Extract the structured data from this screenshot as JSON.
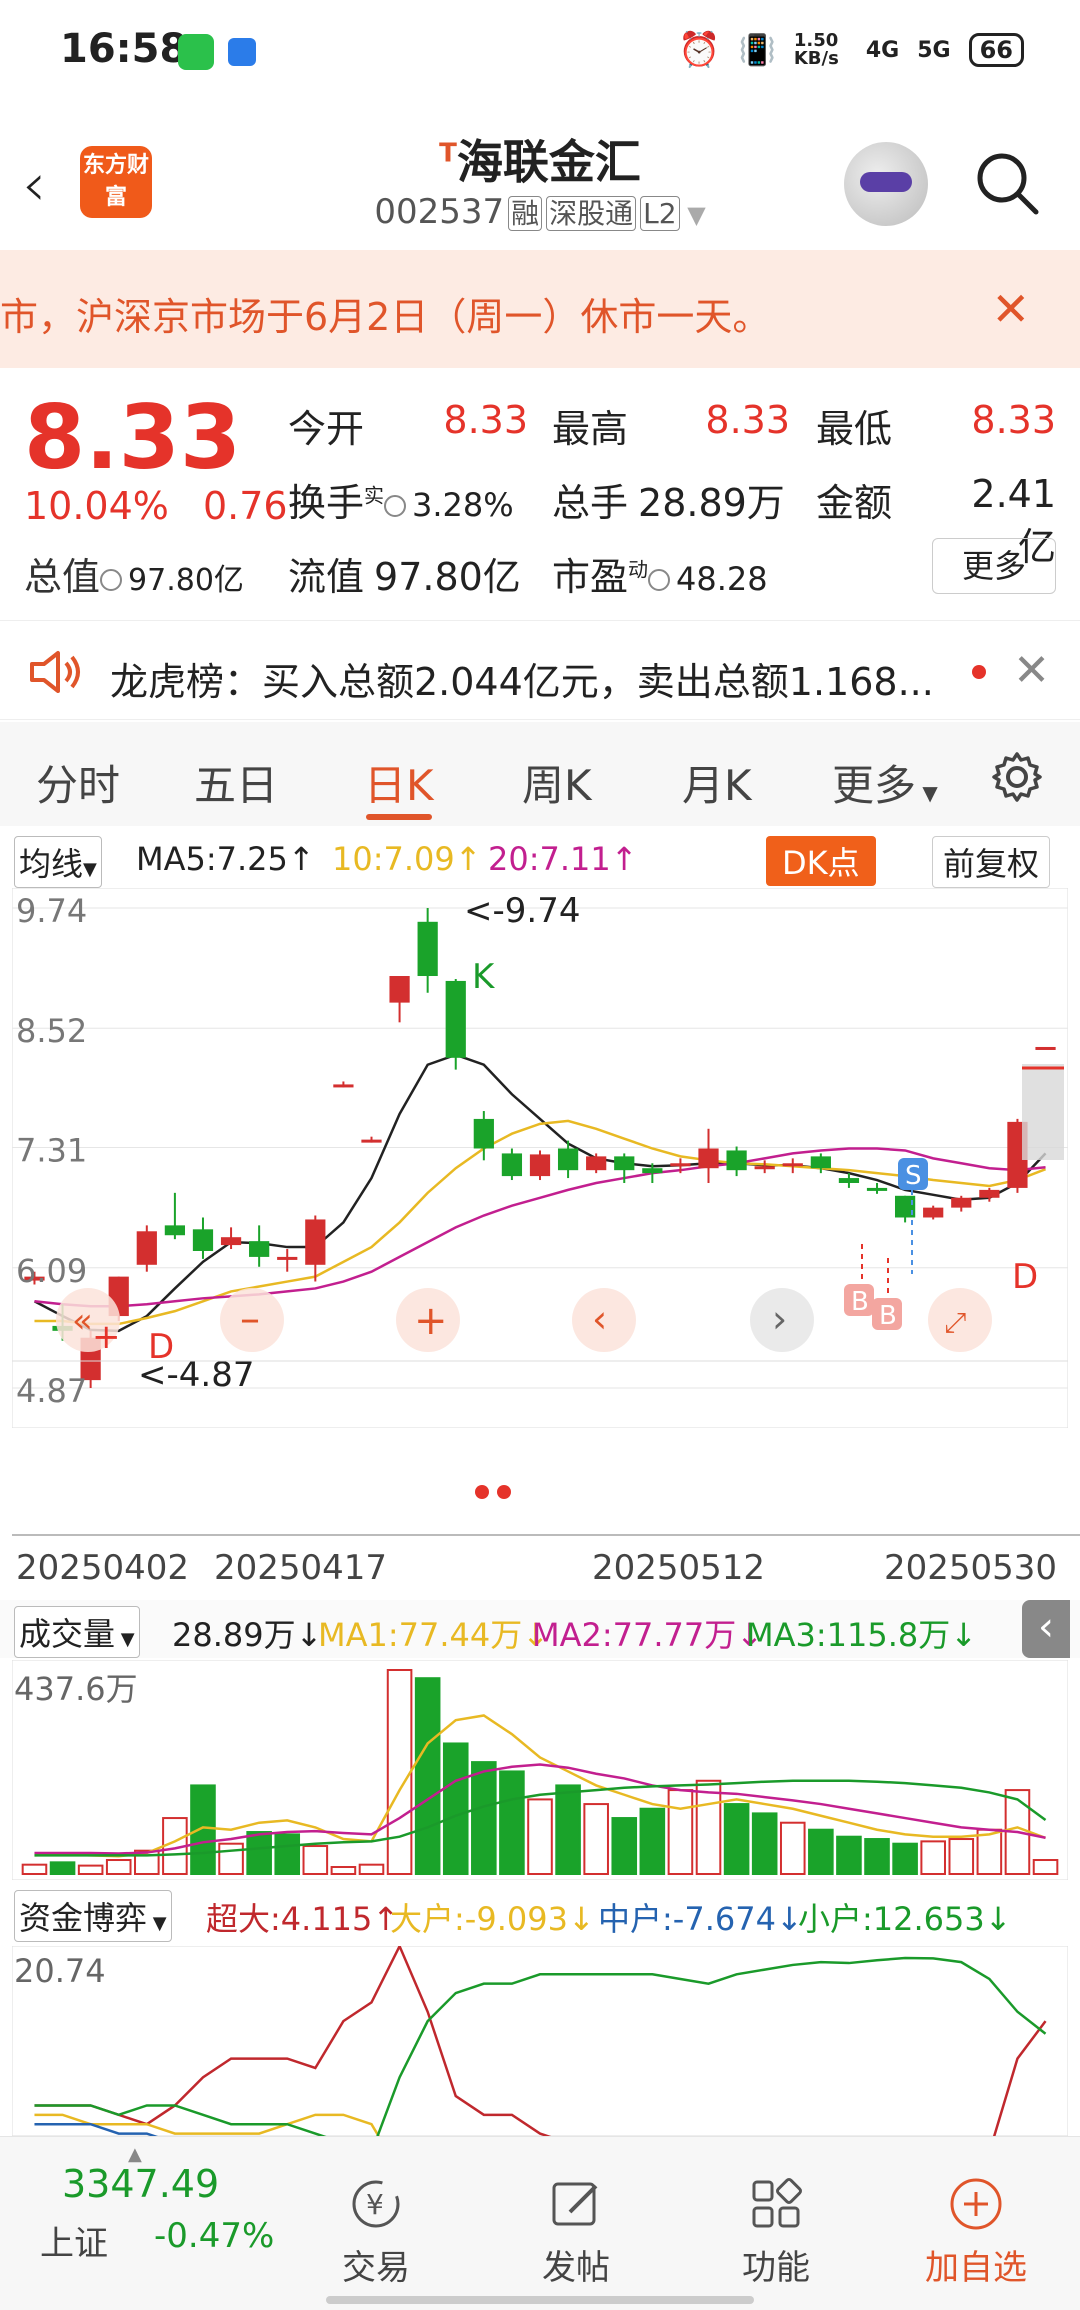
{
  "status_bar": {
    "time": "16:58",
    "net_speed": "1.50 KB/s",
    "signal_1": "4G",
    "signal_2": "5G",
    "battery": "66"
  },
  "header": {
    "logo_text": "东方财富",
    "title_prefix": "T",
    "title": "海联金汇",
    "code": "002537",
    "tag_1": "融",
    "tag_2": "深股通",
    "tag_3": "L2"
  },
  "notice": {
    "text": "市，沪深京市场于6月2日（周一）休市一天。"
  },
  "quote": {
    "price": "8.33",
    "change_pct": "10.04%",
    "change": "0.76",
    "open_label": "今开",
    "open": "8.33",
    "high_label": "最高",
    "high": "8.33",
    "low_label": "最低",
    "low": "8.33",
    "turnover_label": "换手",
    "turnover_sup": "实",
    "turnover": "3.28%",
    "volume_label": "总手",
    "volume": "28.89万",
    "amount_label": "金额",
    "amount": "2.41亿",
    "mktcap_label": "总值",
    "mktcap": "97.80亿",
    "float_label": "流值",
    "float_cap": "97.80亿",
    "pe_label": "市盈",
    "pe_sup": "动",
    "pe": "48.28",
    "more_label": "更多"
  },
  "lhb": {
    "text": "龙虎榜：买入总额2.044亿元，卖出总额1.168..."
  },
  "tabs": [
    "分时",
    "五日",
    "日K",
    "周K",
    "月K",
    "更多"
  ],
  "active_tab": "日K",
  "ma_bar": {
    "selector": "均线",
    "ma5": "MA5:7.25",
    "ma10": "10:7.09",
    "ma20": "20:7.11",
    "dk_label": "DK点",
    "adjust_label": "前复权",
    "color_ma5": "#222222",
    "color_ma10": "#e8b923",
    "color_ma20": "#c21f8f"
  },
  "kline_labels": {
    "y_ticks": [
      "9.74",
      "8.52",
      "7.31",
      "6.09",
      "4.87"
    ],
    "high_note": "<-9.74",
    "low_note": "<-4.87",
    "k_mark": "K",
    "d_mark": "D",
    "s_mark": "S",
    "b_mark": "B",
    "dates": [
      "20250402",
      "20250417",
      "20250512",
      "20250530"
    ]
  },
  "volume_bar": {
    "selector": "成交量",
    "value": "28.89万",
    "ma1": "MA1:77.44万",
    "ma2": "MA2:77.77万",
    "ma3": "MA3:115.8万",
    "y_top": "437.6万",
    "color_ma1": "#e8b923",
    "color_ma2": "#c21f8f",
    "color_ma3": "#1a9a2a"
  },
  "fund_bar": {
    "selector": "资金博弈",
    "super": "超大:4.115",
    "large": "大户:-9.093",
    "mid": "中户:-7.674",
    "small": "小户:12.653",
    "y_top": "20.74",
    "color_super": "#c0282d",
    "color_large": "#e8b923",
    "color_mid": "#2563b0",
    "color_small": "#1a9a2a"
  },
  "chart_data": {
    "type": "candlestick",
    "y_range": [
      4.87,
      9.74
    ],
    "candles": [
      {
        "o": 6.0,
        "h": 6.05,
        "l": 5.92,
        "c": 5.96,
        "up": true
      },
      {
        "o": 5.5,
        "h": 5.72,
        "l": 5.35,
        "c": 5.45,
        "up": false
      },
      {
        "o": 4.95,
        "h": 5.45,
        "l": 4.87,
        "c": 5.38,
        "up": true
      },
      {
        "o": 5.6,
        "h": 6.0,
        "l": 5.55,
        "c": 6.0,
        "up": true
      },
      {
        "o": 6.12,
        "h": 6.52,
        "l": 6.05,
        "c": 6.46,
        "up": true
      },
      {
        "o": 6.52,
        "h": 6.85,
        "l": 6.38,
        "c": 6.42,
        "up": false
      },
      {
        "o": 6.48,
        "h": 6.6,
        "l": 6.18,
        "c": 6.26,
        "up": false
      },
      {
        "o": 6.32,
        "h": 6.5,
        "l": 6.28,
        "c": 6.4,
        "up": true
      },
      {
        "o": 6.36,
        "h": 6.52,
        "l": 6.1,
        "c": 6.2,
        "up": false
      },
      {
        "o": 6.2,
        "h": 6.28,
        "l": 6.05,
        "c": 6.18,
        "up": true
      },
      {
        "o": 6.12,
        "h": 6.62,
        "l": 5.95,
        "c": 6.58,
        "up": true
      },
      {
        "o": 7.95,
        "h": 7.98,
        "l": 7.92,
        "c": 7.95,
        "up": true
      },
      {
        "o": 7.39,
        "h": 7.42,
        "l": 7.36,
        "c": 7.39,
        "up": true
      },
      {
        "o": 8.78,
        "h": 9.0,
        "l": 8.58,
        "c": 9.05,
        "up": true
      },
      {
        "o": 9.05,
        "h": 9.74,
        "l": 8.88,
        "c": 9.6,
        "up": false
      },
      {
        "o": 9.0,
        "h": 9.02,
        "l": 8.1,
        "c": 8.22,
        "up": false
      },
      {
        "o": 7.6,
        "h": 7.68,
        "l": 7.18,
        "c": 7.3,
        "up": false
      },
      {
        "o": 7.25,
        "h": 7.3,
        "l": 6.98,
        "c": 7.02,
        "up": false
      },
      {
        "o": 7.02,
        "h": 7.28,
        "l": 6.98,
        "c": 7.24,
        "up": true
      },
      {
        "o": 7.3,
        "h": 7.38,
        "l": 7.0,
        "c": 7.08,
        "up": false
      },
      {
        "o": 7.08,
        "h": 7.25,
        "l": 7.05,
        "c": 7.22,
        "up": true
      },
      {
        "o": 7.22,
        "h": 7.25,
        "l": 6.95,
        "c": 7.08,
        "up": false
      },
      {
        "o": 7.1,
        "h": 7.15,
        "l": 6.95,
        "c": 7.05,
        "up": false
      },
      {
        "o": 7.12,
        "h": 7.2,
        "l": 7.05,
        "c": 7.15,
        "up": true
      },
      {
        "o": 7.1,
        "h": 7.5,
        "l": 6.95,
        "c": 7.3,
        "up": true
      },
      {
        "o": 7.28,
        "h": 7.32,
        "l": 7.02,
        "c": 7.08,
        "up": false
      },
      {
        "o": 7.12,
        "h": 7.18,
        "l": 7.05,
        "c": 7.12,
        "up": true
      },
      {
        "o": 7.15,
        "h": 7.2,
        "l": 7.05,
        "c": 7.15,
        "up": true
      },
      {
        "o": 7.22,
        "h": 7.25,
        "l": 7.05,
        "c": 7.1,
        "up": false
      },
      {
        "o": 7.0,
        "h": 7.05,
        "l": 6.9,
        "c": 6.95,
        "up": false
      },
      {
        "o": 6.9,
        "h": 6.95,
        "l": 6.84,
        "c": 6.88,
        "up": false
      },
      {
        "o": 6.82,
        "h": 6.82,
        "l": 6.55,
        "c": 6.6,
        "up": false
      },
      {
        "o": 6.6,
        "h": 6.72,
        "l": 6.58,
        "c": 6.7,
        "up": true
      },
      {
        "o": 6.7,
        "h": 6.82,
        "l": 6.66,
        "c": 6.8,
        "up": true
      },
      {
        "o": 6.8,
        "h": 6.9,
        "l": 6.76,
        "c": 6.88,
        "up": true
      },
      {
        "o": 6.9,
        "h": 7.6,
        "l": 6.85,
        "c": 7.57,
        "up": true
      },
      {
        "o": 8.33,
        "h": 8.33,
        "l": 8.33,
        "c": 8.33,
        "up": true
      }
    ],
    "ma5": [
      5.75,
      5.6,
      5.46,
      5.45,
      5.6,
      5.88,
      6.15,
      6.35,
      6.34,
      6.3,
      6.3,
      6.55,
      7.0,
      7.65,
      8.15,
      8.25,
      8.15,
      7.85,
      7.6,
      7.35,
      7.2,
      7.15,
      7.12,
      7.13,
      7.15,
      7.15,
      7.13,
      7.13,
      7.1,
      7.05,
      6.98,
      6.88,
      6.83,
      6.78,
      6.8,
      6.95,
      7.25
    ],
    "ma10": [
      5.55,
      5.55,
      5.52,
      5.52,
      5.58,
      5.65,
      5.75,
      5.85,
      5.9,
      5.95,
      6.0,
      6.15,
      6.3,
      6.55,
      6.85,
      7.1,
      7.3,
      7.45,
      7.55,
      7.58,
      7.5,
      7.4,
      7.3,
      7.22,
      7.18,
      7.15,
      7.14,
      7.12,
      7.1,
      7.08,
      7.05,
      7.02,
      6.98,
      6.95,
      6.92,
      6.98,
      7.09
    ],
    "ma20": [
      5.75,
      5.72,
      5.7,
      5.7,
      5.72,
      5.75,
      5.78,
      5.8,
      5.82,
      5.85,
      5.88,
      5.95,
      6.05,
      6.2,
      6.35,
      6.5,
      6.62,
      6.72,
      6.8,
      6.88,
      6.95,
      7.0,
      7.05,
      7.08,
      7.12,
      7.15,
      7.2,
      7.25,
      7.28,
      7.3,
      7.3,
      7.28,
      7.2,
      7.15,
      7.1,
      7.08,
      7.11
    ],
    "volume_max": 437.6,
    "volumes": [
      20,
      25,
      18,
      30,
      50,
      120,
      190,
      65,
      90,
      85,
      60,
      15,
      20,
      437.6,
      420,
      280,
      240,
      220,
      160,
      190,
      150,
      120,
      140,
      180,
      200,
      150,
      130,
      110,
      95,
      80,
      75,
      65,
      70,
      75,
      95,
      180,
      30
    ],
    "vol_up": [
      true,
      false,
      true,
      true,
      true,
      true,
      false,
      true,
      false,
      false,
      true,
      true,
      true,
      true,
      false,
      false,
      false,
      false,
      true,
      false,
      true,
      false,
      false,
      true,
      true,
      false,
      false,
      true,
      false,
      false,
      false,
      false,
      true,
      true,
      true,
      true,
      true
    ],
    "vma1": [
      40,
      42,
      40,
      38,
      45,
      70,
      100,
      95,
      110,
      115,
      100,
      75,
      70,
      180,
      280,
      330,
      340,
      300,
      250,
      220,
      190,
      170,
      150,
      140,
      150,
      160,
      150,
      140,
      125,
      110,
      95,
      85,
      80,
      80,
      85,
      100,
      77.44
    ],
    "vma2": [
      45,
      45,
      45,
      44,
      46,
      55,
      68,
      75,
      85,
      90,
      92,
      88,
      85,
      120,
      160,
      200,
      220,
      230,
      235,
      228,
      215,
      205,
      190,
      180,
      175,
      172,
      165,
      158,
      150,
      140,
      130,
      120,
      110,
      100,
      95,
      90,
      77.77
    ],
    "vma3": [
      40,
      40,
      40,
      40,
      40,
      42,
      45,
      50,
      55,
      60,
      65,
      68,
      70,
      80,
      100,
      125,
      145,
      160,
      170,
      175,
      180,
      185,
      188,
      190,
      192,
      195,
      198,
      200,
      200,
      200,
      198,
      195,
      190,
      185,
      175,
      160,
      115.8
    ],
    "fund_super": [
      5,
      5,
      5,
      4,
      3,
      5,
      8,
      10,
      10,
      10,
      9,
      14,
      16,
      22,
      15,
      6,
      4,
      4,
      2,
      1,
      0,
      0,
      0,
      0,
      0,
      0,
      0,
      0,
      0,
      0,
      0,
      0,
      0,
      0,
      0,
      10,
      14
    ],
    "fund_large": [
      4,
      4,
      3,
      3,
      3,
      2,
      2,
      2,
      2,
      3,
      4,
      4,
      3,
      -2,
      -8,
      -10,
      -10,
      -10,
      -10,
      -10,
      -10,
      -10,
      -10,
      -10,
      -10,
      -10,
      -10,
      -10,
      -10,
      -10,
      -10,
      -10,
      -10,
      -10,
      -10,
      -10,
      -9.093
    ],
    "fund_mid": [
      3,
      3,
      3,
      2,
      2,
      1,
      0,
      0,
      1,
      1,
      0,
      -1,
      -2,
      -6,
      -8,
      -8,
      -8,
      -8,
      -8,
      -8,
      -8,
      -8,
      -8,
      -8,
      -8,
      -8,
      -8,
      -8,
      -8,
      -8,
      -8,
      -8,
      -8,
      -8,
      -8,
      -8,
      -7.674
    ],
    "fund_small": [
      5,
      5,
      5,
      4,
      5,
      5,
      4,
      3,
      3,
      3,
      2,
      1,
      0,
      8,
      14,
      17,
      18,
      18,
      19,
      19,
      19,
      19,
      19,
      18.5,
      18,
      19,
      19.5,
      20,
      20.3,
      20.2,
      20.5,
      20.74,
      20.7,
      20.3,
      18.5,
      15,
      12.653
    ]
  },
  "bottom_nav": {
    "index_value": "3347.49",
    "index_name": "上证",
    "index_change": "-0.47%",
    "items": [
      "交易",
      "发帖",
      "功能",
      "加自选"
    ]
  }
}
